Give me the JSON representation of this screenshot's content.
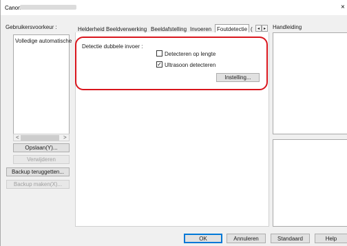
{
  "window": {
    "title_brand": "Canon",
    "close_glyph": "×"
  },
  "left": {
    "prefs_label": "Gebruikersvoorkeur :",
    "list_items": [
      "Volledige automatische"
    ],
    "scroll_left": "<",
    "scroll_right": ">",
    "save_button": "Opslaan(Y)...",
    "delete_button": "Verwijderen",
    "restore_button": "Backup teruggetten...",
    "create_backup_button": "Backup maken(X)..."
  },
  "tabs": [
    {
      "label": "Helderheid",
      "selected": false
    },
    {
      "label": "Beeldverwerking",
      "selected": false
    },
    {
      "label": "Beeldafstelling",
      "selected": false
    },
    {
      "label": "Invoeren",
      "selected": false
    },
    {
      "label": "Foutdetectie",
      "selected": true
    },
    {
      "label": "(",
      "selected": false
    }
  ],
  "tab_scroll": {
    "left": "◂",
    "right": "▸"
  },
  "panel": {
    "group_label": "Detectie dubbele invoer :",
    "checkboxes": [
      {
        "label": "Detecteren op lengte",
        "checked": false
      },
      {
        "label": "Ultrasoon detecteren",
        "checked": true
      }
    ],
    "settings_button": "Instelling..."
  },
  "right": {
    "manual_label": "Handleiding"
  },
  "footer": {
    "ok": "OK",
    "cancel": "Annuleren",
    "default": "Standaard",
    "help": "Help"
  },
  "colors": {
    "highlight": "#d9141c",
    "focus": "#0078d7"
  }
}
